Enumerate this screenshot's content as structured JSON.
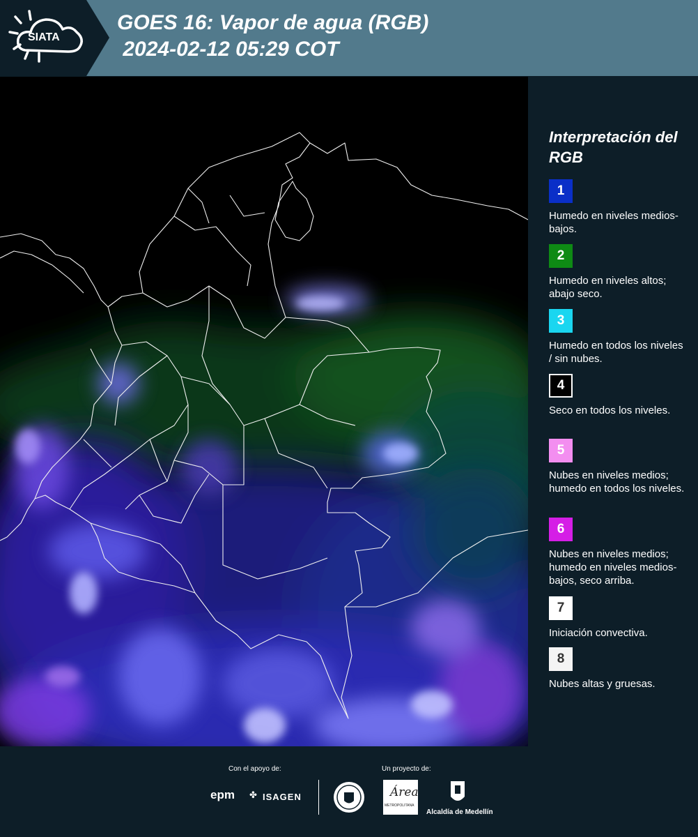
{
  "header": {
    "logo_text": "SIATA",
    "title_line1": "GOES 16: Vapor de agua (RGB)",
    "title_line2": " 2024-02-12 05:29 COT"
  },
  "map": {
    "description_icon": "satellite-water-vapor-map"
  },
  "legend": {
    "title": "Interpretación del RGB",
    "items": [
      {
        "number": "1",
        "color": "#0a2fc8",
        "text": "Humedo en niveles medios-bajos."
      },
      {
        "number": "2",
        "color": "#0e8a14",
        "text": "Humedo en niveles altos; abajo seco."
      },
      {
        "number": "3",
        "color": "#1ad6f0",
        "text": "Humedo en todos los niveles / sin nubes."
      },
      {
        "number": "4",
        "color": "#000000",
        "text": "Seco en todos los niveles."
      },
      {
        "number": "5",
        "color": "#f38ef0",
        "text": "Nubes en niveles medios; humedo en todos los niveles."
      },
      {
        "number": "6",
        "color": "#d51ee6",
        "text": "Nubes en niveles medios; humedo en niveles medios-bajos, seco arriba."
      },
      {
        "number": "7",
        "color": "#ffffff",
        "text": "Iniciación convectiva."
      },
      {
        "number": "8",
        "color": "#f4f4f4",
        "text": "Nubes altas y gruesas."
      }
    ]
  },
  "footer": {
    "support_label": "Con el apoyo de:",
    "project_label": "Un proyecto de:",
    "sponsor_epm": "epm",
    "sponsor_isagen": "ISAGEN",
    "partner_area": "Área",
    "partner_area_sub": "METROPOLITANA",
    "partner_medellin": "Alcaldía de Medellín"
  }
}
